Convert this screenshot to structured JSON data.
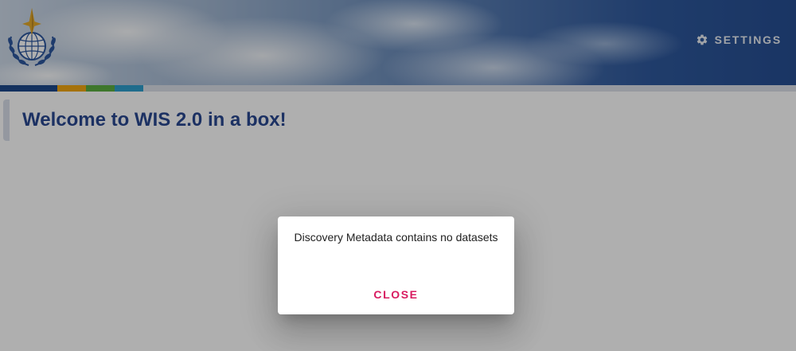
{
  "header": {
    "logo_icon": "wmo-emblem-icon",
    "settings_icon": "gear-icon",
    "settings_label": "SETTINGS",
    "stripe_colors": [
      "#0b3a82",
      "#f0a000",
      "#4fa832",
      "#1f97c8"
    ]
  },
  "main": {
    "title": "Welcome to WIS 2.0 in a box!"
  },
  "dialog": {
    "message": "Discovery Metadata contains no datasets",
    "close_label": "CLOSE",
    "close_color": "#d81b60"
  },
  "colors": {
    "title_text": "#1a3b88",
    "overlay": "rgba(33,33,33,0.36)"
  }
}
